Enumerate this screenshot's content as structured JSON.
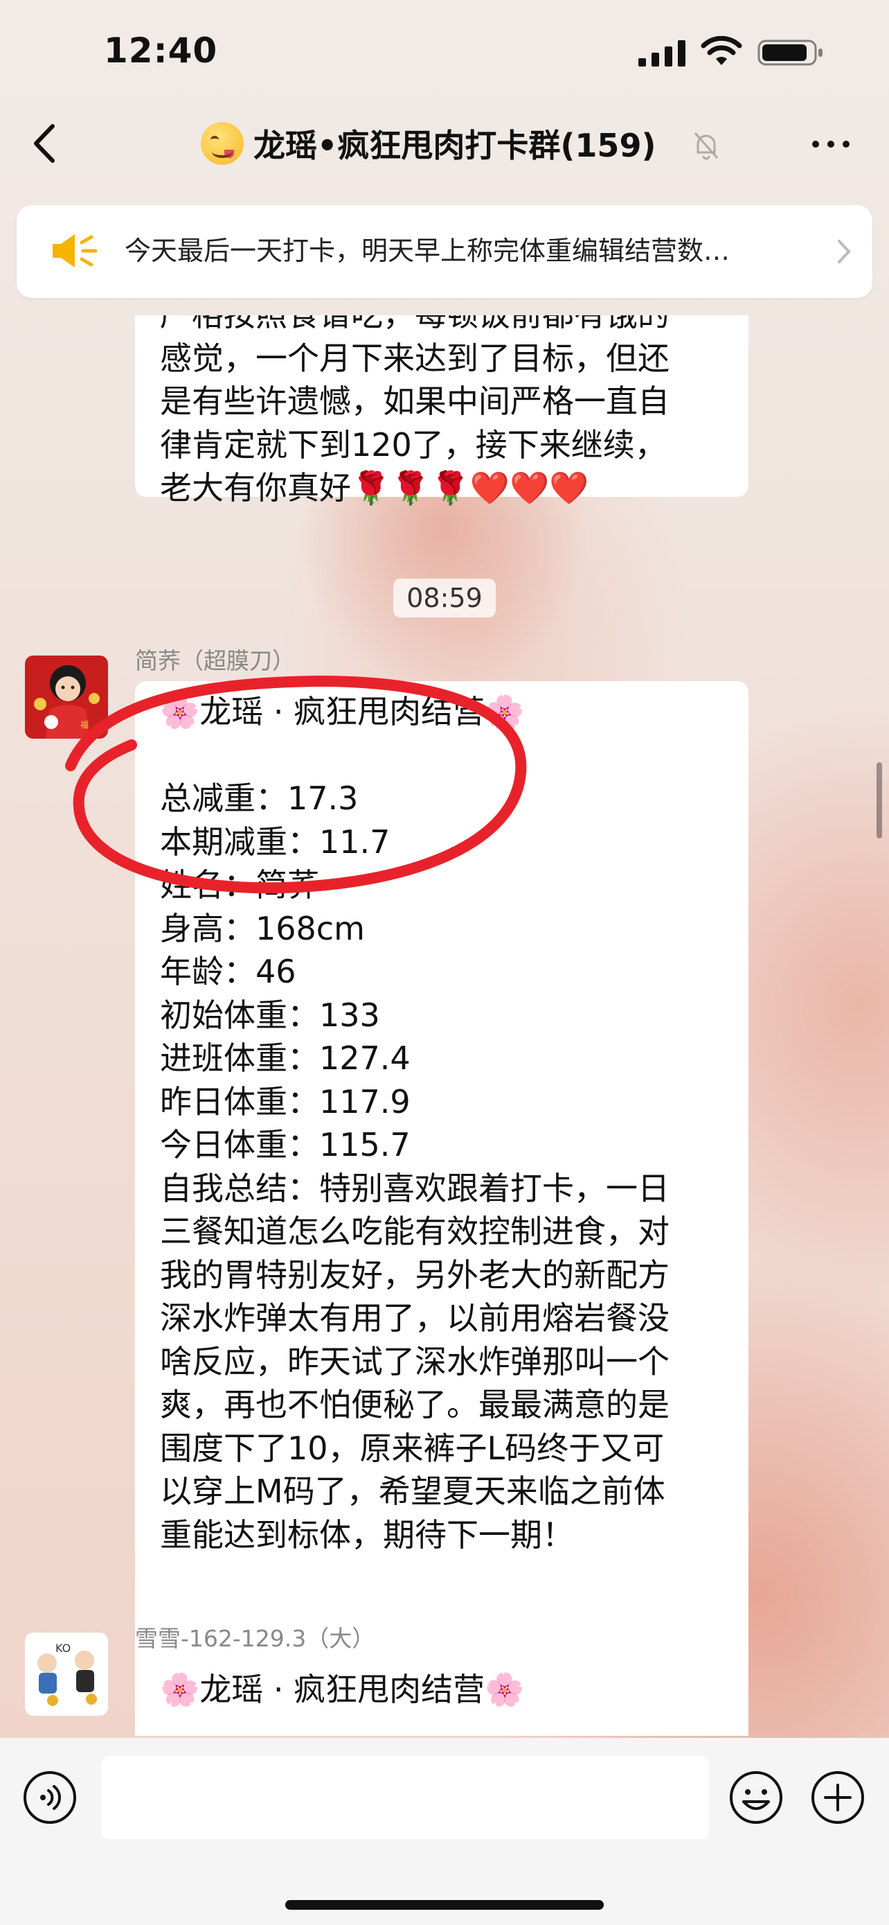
{
  "status_bar": {
    "time": "12:40"
  },
  "nav": {
    "title": "龙瑶•疯狂甩肉打卡群(159)"
  },
  "announcement": {
    "text": "今天最后一天打卡，明天早上称完体重编辑结营数…"
  },
  "messages": {
    "prev_bubble": {
      "lines": [
        "严格按照食谱吃，每顿饭前都有饿的",
        "感觉，一个月下来达到了目标，但还",
        "是有些许遗憾，如果中间严格一直自",
        "律肯定就下到120了，接下来继续，",
        "老大有你真好🌹🌹🌹❤️❤️❤️"
      ]
    },
    "timestamp": "08:59",
    "msg1": {
      "sender": "简荞（超膜刀）",
      "lines": [
        "🌸龙瑶 · 疯狂甩肉结营🌸",
        "",
        "总减重：17.3",
        "本期减重：11.7",
        "姓名：简荞",
        "身高：168cm",
        "年龄：46",
        "初始体重：133",
        "进班体重：127.4",
        "昨日体重：117.9",
        "今日体重：115.7",
        "自我总结：特别喜欢跟着打卡，一日",
        "三餐知道怎么吃能有效控制进食，对",
        "我的胃特别友好，另外老大的新配方",
        "深水炸弹太有用了，以前用熔岩餐没",
        "啥反应，昨天试了深水炸弹那叫一个",
        "爽，再也不怕便秘了。最最满意的是",
        "围度下了10，原来裤子L码终于又可",
        "以穿上M码了，希望夏天来临之前体",
        "重能达到标体，期待下一期！"
      ]
    },
    "msg2": {
      "sender": "雪雪-162-129.3（大）",
      "lines": [
        "🌸龙瑶 · 疯狂甩肉结营🌸"
      ]
    }
  },
  "input_bar": {
    "placeholder": ""
  },
  "colors": {
    "annotation_red": "#e8222a",
    "bubble": "#ffffff",
    "accent_yellow": "#f5b400"
  },
  "icons": [
    "back-chevron-icon",
    "mute-bell-icon",
    "more-icon",
    "speaker-icon",
    "chevron-right-icon",
    "voice-icon",
    "emoji-icon",
    "plus-icon"
  ]
}
